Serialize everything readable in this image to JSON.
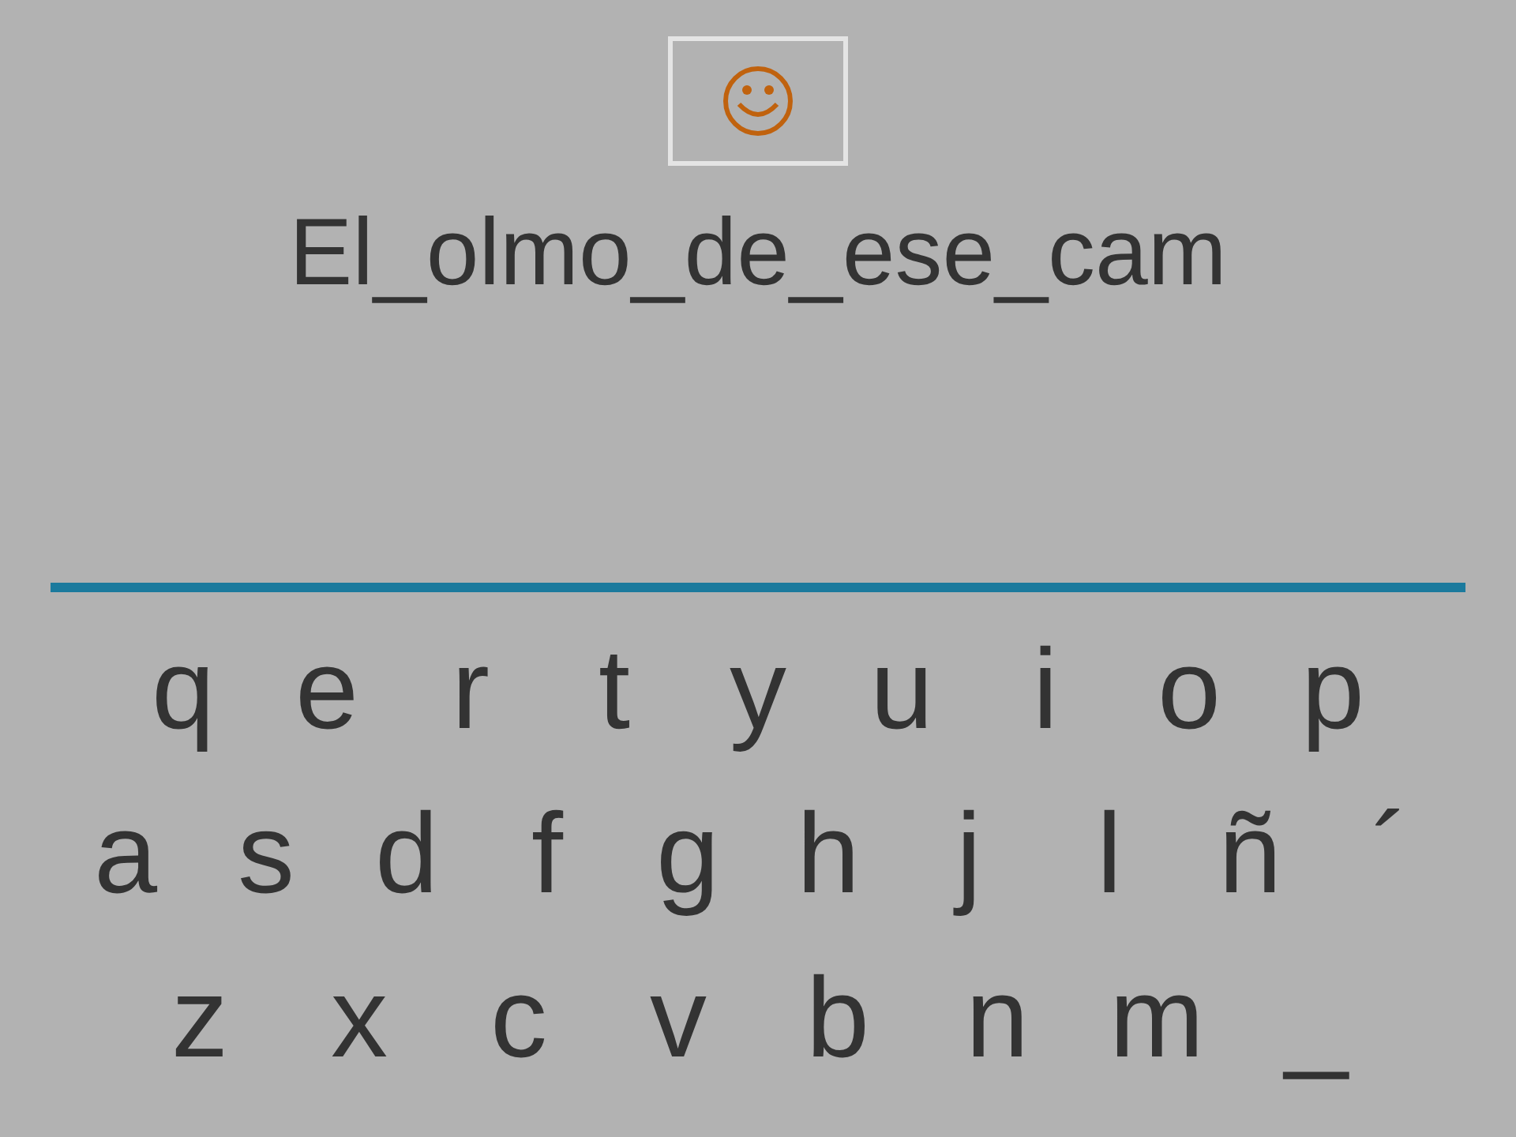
{
  "prompt": {
    "text": "El_olmo_de_ese_cam"
  },
  "keyboard": {
    "rows": [
      [
        "q",
        "e",
        "r",
        "t",
        "y",
        "u",
        "i",
        "o",
        "p"
      ],
      [
        "a",
        "s",
        "d",
        "f",
        "g",
        "h",
        "j",
        "l",
        "ñ",
        "´"
      ],
      [
        "z",
        "x",
        "c",
        "v",
        "b",
        "n",
        "m",
        "_"
      ]
    ]
  }
}
